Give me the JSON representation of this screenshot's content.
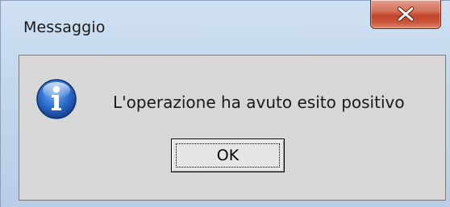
{
  "window": {
    "title": "Messaggio",
    "close_icon": "close-icon"
  },
  "dialog": {
    "icon": "info-icon",
    "message": "L'operazione ha avuto esito positivo",
    "ok_label": "OK"
  },
  "colors": {
    "close_button": "#c2452a",
    "info_icon": "#1f5fc0",
    "content_background": "#d7d7d7"
  }
}
